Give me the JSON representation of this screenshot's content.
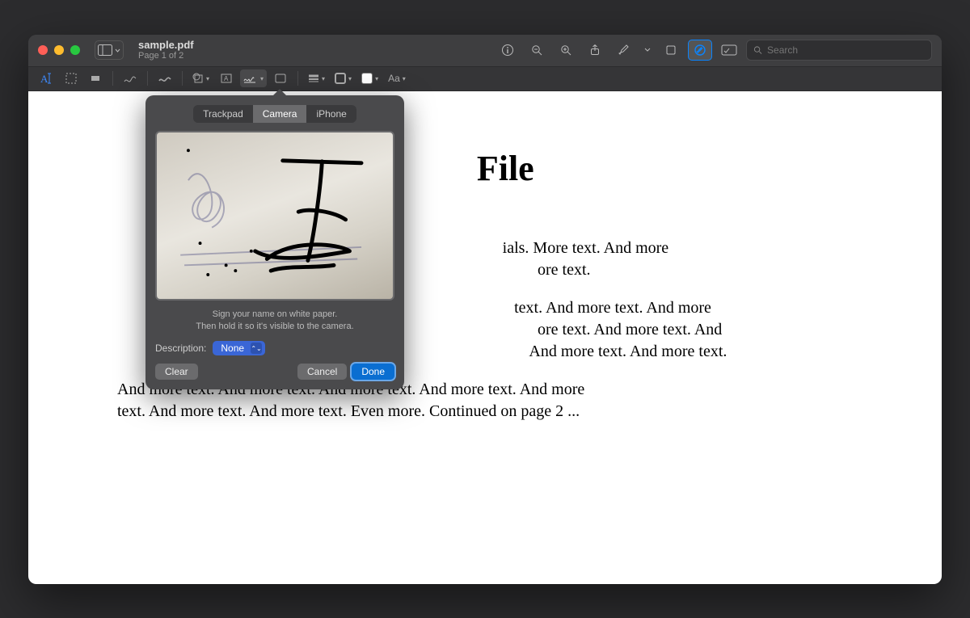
{
  "window": {
    "title": "sample.pdf",
    "subtitle": "Page 1 of 2",
    "search_placeholder": "Search"
  },
  "markup": {
    "text_style_label": "Aa"
  },
  "document": {
    "heading_suffix": "File",
    "p1_tail": "ials. More text. And more",
    "p1_line2_tail": "ore text.",
    "p2_line1_tail": "text. And more text. And more",
    "p2_line2_tail": "ore text. And more text. And",
    "p2_line3_tail": " And more text. And more text.",
    "p3_line1": "And more text. And more text. And more text. And more text. And more",
    "p3_line2": "text. And more text. And more text. Even more. Continued on page 2 ..."
  },
  "popover": {
    "tabs": {
      "trackpad": "Trackpad",
      "camera": "Camera",
      "iphone": "iPhone"
    },
    "instr_line1": "Sign your name on white paper.",
    "instr_line2": "Then hold it so it's visible to the camera.",
    "description_label": "Description:",
    "description_value": "None",
    "clear": "Clear",
    "cancel": "Cancel",
    "done": "Done"
  }
}
